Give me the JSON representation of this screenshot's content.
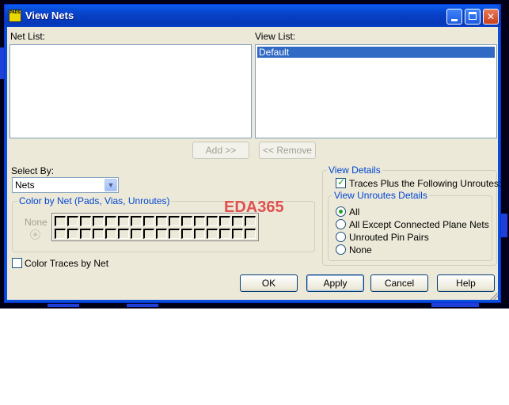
{
  "window": {
    "title": "View Nets",
    "app_icon_text": "PADS",
    "minimize_icon": "minimize-icon",
    "maximize_icon": "maximize-icon",
    "close_icon": "close-icon"
  },
  "net_list": {
    "label": "Net List:",
    "items": []
  },
  "view_list": {
    "label": "View List:",
    "items": [
      "Default"
    ],
    "selected": "Default"
  },
  "buttons": {
    "add": "Add >>",
    "remove": "<< Remove",
    "ok": "OK",
    "apply": "Apply",
    "cancel": "Cancel",
    "help": "Help"
  },
  "select_by": {
    "label": "Select By:",
    "value": "Nets"
  },
  "color_by_net": {
    "title": "Color by Net (Pads, Vias, Unroutes)",
    "none_label": "None",
    "rows": 2,
    "cols": 16
  },
  "color_traces": {
    "label": "Color Traces by Net",
    "checked": false
  },
  "view_details": {
    "title": "View Details",
    "traces_plus": {
      "label": "Traces Plus the Following Unroutes:",
      "checked": true
    },
    "unroutes_title": "View Unroutes Details",
    "options": [
      "All",
      "All Except Connected Plane Nets",
      "Unrouted Pin Pairs",
      "None"
    ],
    "selected": "All"
  },
  "watermark": "EDA365",
  "colors": {
    "dialog_bg": "#ece9d8",
    "titlebar": "#0842c8",
    "selection": "#316ac5",
    "group_title": "#0046d5"
  }
}
